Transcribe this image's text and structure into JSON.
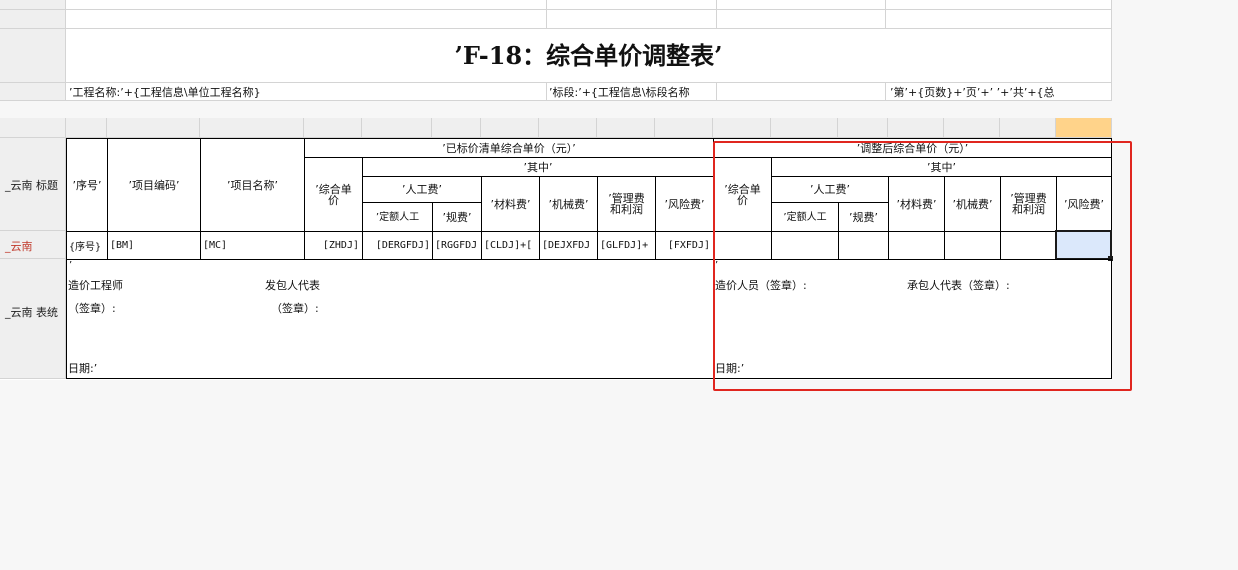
{
  "title": "’F-18：综合单价调整表’",
  "info": {
    "project_name": "’工程名称:’+{工程信息\\单位工程名称}",
    "section": "’标段:’+{工程信息\\标段名称",
    "page": "’第’+{页数}+’页’+’ ’+’共’+{总"
  },
  "side": {
    "title_label": "_云南 标题",
    "data_label": "_云南",
    "footer_label": "_云南 表统"
  },
  "headers": {
    "seq": "’序号’",
    "code": "’项目编码’",
    "name": "’项目名称’",
    "left_group": "’已标价清单综合单价（元）’",
    "right_group": "’调整后综合单价（元）’",
    "of_which": "’其中’",
    "unit_price": "’综合单价",
    "labor": "’人工费’",
    "labor_quota": "’定额人工",
    "labor_fee": "’规费’",
    "material": "’材料费’",
    "machine": "’机械费’",
    "mgmt": "’管理费和利润",
    "risk": "’风险费’"
  },
  "data_row": {
    "seq": "{序号}",
    "code": "[BM]",
    "name": "[MC]",
    "zhdj": "[ZHDJ]",
    "dergfdj": "[DERGFDJ]",
    "rggfdj": "[RGGFDJ",
    "cldj": "[CLDJ]+[",
    "dejxfdj": "[DEJXFDJ",
    "glfdj": "[GLFDJ]+",
    "fxfdj": "[FXFDJ]"
  },
  "footer": {
    "tick": "’",
    "cost_engineer": "造价工程师",
    "sign1": "（签章）:",
    "employer_rep": "发包人代表",
    "sign2": "（签章）:",
    "date_left": "日期:’",
    "cost_person": "造价人员（签章）:",
    "contractor_rep": "承包人代表（签章）:",
    "date_right": "日期:’"
  },
  "colors": {
    "highlight_box": "#e0261f",
    "selected_cell": "#dbe8fb",
    "col_header_hl": "#ffd38a"
  }
}
